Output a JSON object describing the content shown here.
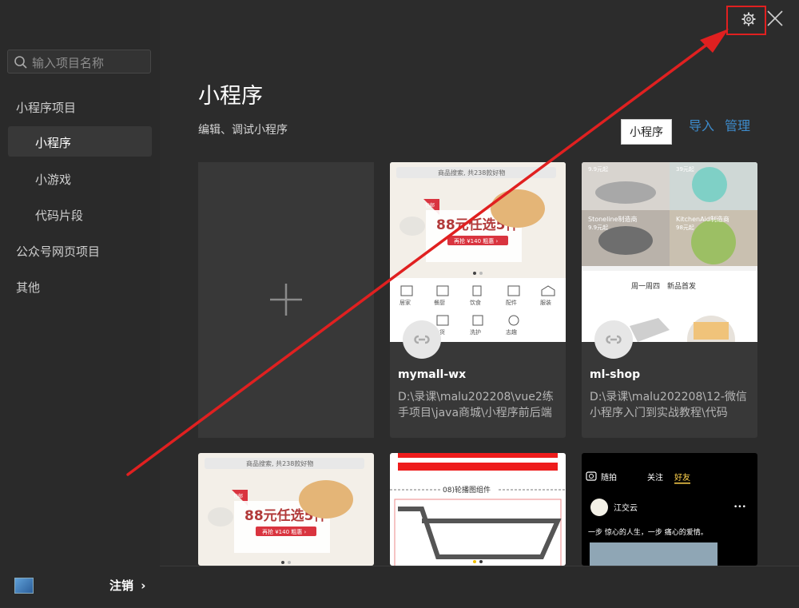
{
  "search": {
    "placeholder": "输入项目名称"
  },
  "sidebar": {
    "items": [
      {
        "label": "小程序项目"
      },
      {
        "label": "小程序"
      },
      {
        "label": "小游戏"
      },
      {
        "label": "代码片段"
      },
      {
        "label": "公众号网页项目"
      },
      {
        "label": "其他"
      }
    ],
    "logout": "注销",
    "logout_chevron": "›"
  },
  "header": {
    "title": "小程序",
    "subtitle": "编辑、调试小程序",
    "import_label": "导入",
    "manage_label": "管理",
    "tooltip": "小程序"
  },
  "projects": [
    {
      "name": "mymall-wx",
      "path": "D:\\录课\\malu202208\\vue2练手项目\\java商城\\小程序前后端",
      "shot": {
        "search_text": "商品搜索, 共238款好物",
        "promo": "88元任选5件",
        "promo_sub": "再抢 ¥140 粗惠 ›",
        "tag": "包邮",
        "icons": [
          "居家",
          "餐厨",
          "饮食",
          "配件",
          "服装",
          "洗护",
          "杂货",
          "志趣"
        ]
      }
    },
    {
      "name": "ml-shop",
      "path": "D:\\录课\\malu202208\\12-微信小程序入门到实战教程\\代码",
      "shot": {
        "price1": "9.9元起",
        "price2": "39元起",
        "brand1": "Stoneline制造商",
        "brand1_price": "9.9元起",
        "brand2": "KitchenAid制造商",
        "brand2_price": "98元起",
        "section": "周一周四　新品首发"
      }
    },
    {
      "shot": {
        "search_text": "商品搜索, 共238款好物",
        "promo": "88元任选5件",
        "promo_sub": "再抢 ¥140 粗惠 ›",
        "tag": "包邮"
      }
    },
    {
      "shot": {
        "caption": "08)轮播图组件"
      }
    },
    {
      "shot": {
        "tab_shoot": "随拍",
        "tab_follow": "关注",
        "tab_friends": "好友",
        "user": "江交云",
        "post_text": "一步 惊心的人生，一步 痛心的爱情。",
        "more": "•••"
      }
    }
  ],
  "colors": {
    "accent": "#3d8bcb",
    "annotation": "#e02020",
    "promo_red": "#d9343f"
  }
}
